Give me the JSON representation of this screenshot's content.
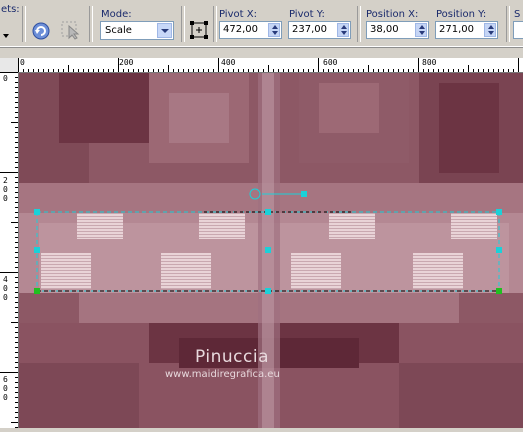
{
  "toolbar": {
    "presets_label": "ets:",
    "mode_label": "Mode:",
    "mode_value": "Scale",
    "pivot_x_label": "Pivot X:",
    "pivot_x_value": "472,00",
    "pivot_y_label": "Pivot Y:",
    "pivot_y_value": "237,00",
    "position_x_label": "Position X:",
    "position_x_value": "38,00",
    "position_y_label": "Position Y:",
    "position_y_value": "271,00",
    "cut_label": "S"
  },
  "ruler": {
    "top_labels": [
      "0",
      "200",
      "400",
      "600",
      "800"
    ],
    "left_labels": [
      [
        "0"
      ],
      [
        "2",
        "0",
        "0"
      ],
      [
        "4",
        "0",
        "0"
      ],
      [
        "6",
        "0",
        "0"
      ]
    ]
  },
  "watermark": {
    "name": "Pinuccia",
    "url": "www.maidiregrafica.eu"
  },
  "colors": {
    "toolbar_bg": "#d4d0c8",
    "canvas_base": "#8b5563",
    "selection_dashes": "#00c8d0",
    "handle_cyan": "#1ad1d9",
    "handle_green": "#20c020"
  },
  "icons": {
    "presets_dropdown": "chevron-down-icon",
    "apply": "circular-arrow-icon",
    "reset": "pointer-icon",
    "pivot": "crosshair-box-icon",
    "mode_dropdown": "chevron-down-icon"
  }
}
